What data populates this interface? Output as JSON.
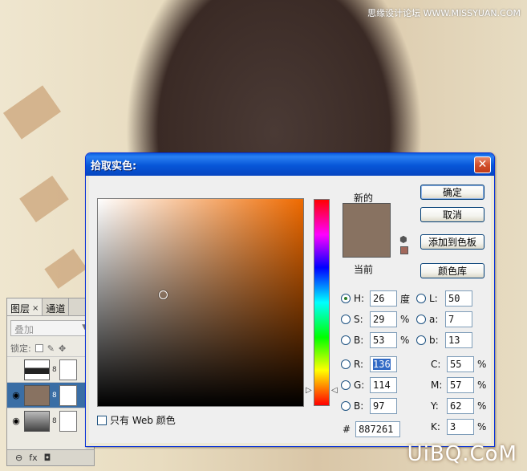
{
  "watermarks": {
    "top": "思缘设计论坛 WWW.MISSYUAN.COM",
    "bottom": "UiBQ.CoM"
  },
  "layers": {
    "tabs": [
      {
        "label": "图层",
        "close": "×"
      },
      {
        "label": "通道"
      }
    ],
    "blend_mode": "叠加",
    "lock_label": "锁定:",
    "footer": "fx"
  },
  "dialog": {
    "title": "拾取实色:",
    "close_glyph": "✕",
    "new_label": "新的",
    "current_label": "当前",
    "web_only_label": "只有 Web 颜色",
    "buttons": {
      "ok": "确定",
      "cancel": "取消",
      "add_swatch": "添加到色板",
      "libraries": "颜色库"
    },
    "hsb": {
      "h": "26",
      "h_unit": "度",
      "s": "29",
      "s_unit": "%",
      "b": "53",
      "b_unit": "%"
    },
    "lab": {
      "l": "50",
      "a": "7",
      "b": "13"
    },
    "rgb": {
      "r": "136",
      "g": "114",
      "b": "97"
    },
    "cmyk": {
      "c": "55",
      "m": "57",
      "y": "62",
      "k": "3",
      "unit": "%"
    },
    "labels": {
      "H": "H:",
      "S": "S:",
      "B": "B:",
      "R": "R:",
      "G": "G:",
      "Bb": "B:",
      "L": "L:",
      "a": "a:",
      "b": "b:",
      "C": "C:",
      "M": "M:",
      "Y": "Y:",
      "K": "K:"
    },
    "hex_label": "#",
    "hex": "887261",
    "colors": {
      "new": "#887261",
      "current": "#887261",
      "gamut": "#a2685b"
    }
  }
}
